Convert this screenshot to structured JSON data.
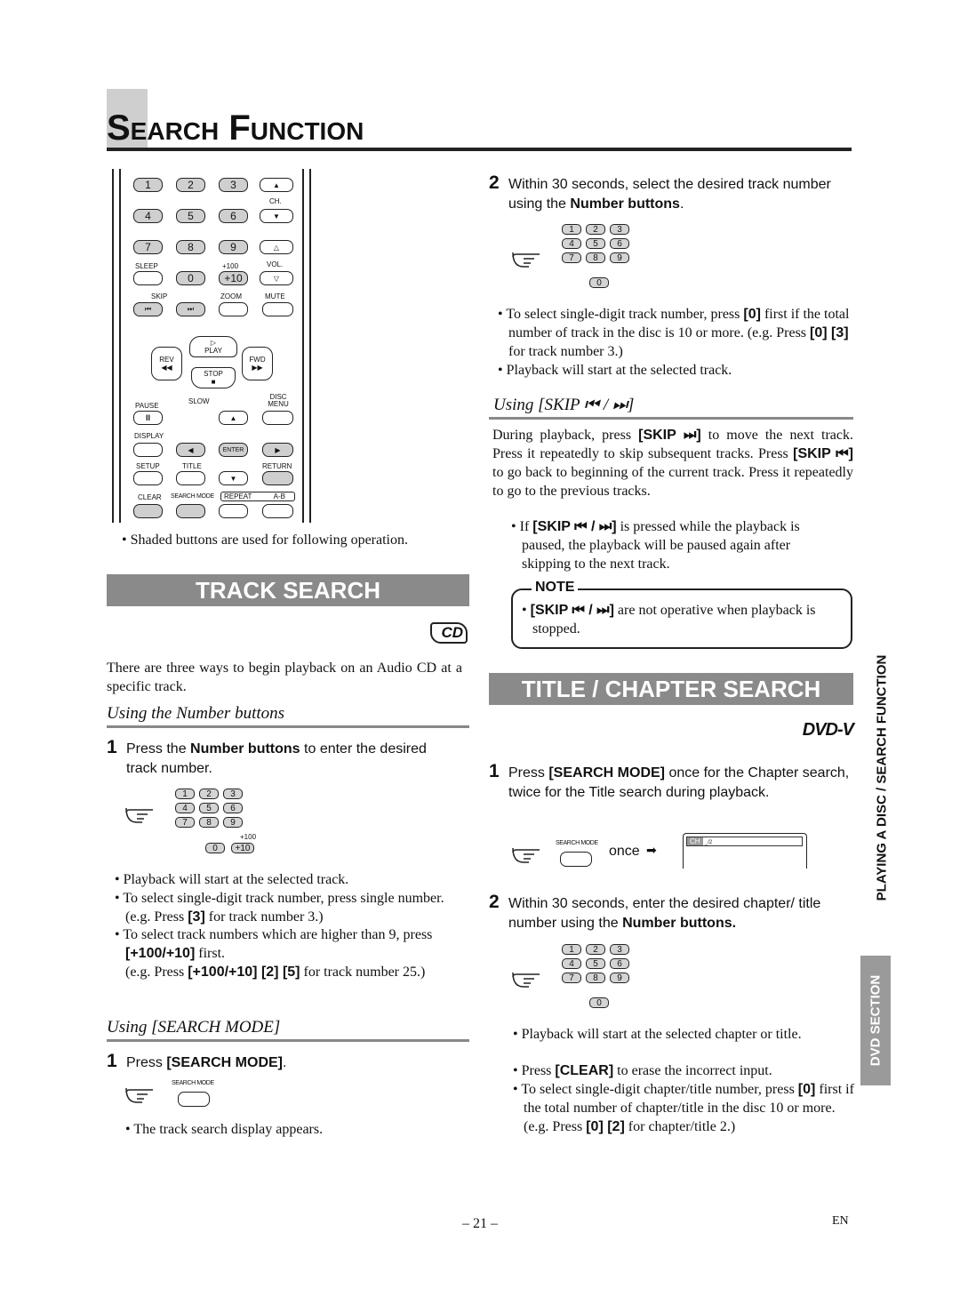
{
  "title": "Search Function",
  "remote": {
    "b1": "1",
    "b2": "2",
    "b3": "3",
    "b4": "4",
    "b5": "5",
    "b6": "6",
    "b7": "7",
    "b8": "8",
    "b9": "9",
    "b0": "0",
    "b10": "+10",
    "ch": "CH.",
    "vol": "VOL.",
    "sleep": "SLEEP",
    "plus100": "+100",
    "skip": "SKIP",
    "zoom": "ZOOM",
    "mute": "MUTE",
    "play": "PLAY",
    "rev": "REV",
    "fwd": "FWD",
    "stop": "STOP",
    "slow": "SLOW",
    "pause": "PAUSE",
    "disc_menu": "DISC MENU",
    "display": "DISPLAY",
    "enter": "ENTER",
    "setup": "SETUP",
    "title": "TITLE",
    "return": "RETURN",
    "clear": "CLEAR",
    "search_mode": "SEARCH MODE",
    "repeat": "REPEAT",
    "ab": "A-B",
    "skip_prev": "⏮",
    "skip_next": "⏭",
    "rev_sym": "◀◀",
    "fwd_sym": "▶▶",
    "stop_sym": "■",
    "pause_sym": "II"
  },
  "caption": "Shaded buttons are used for following operation.",
  "track_search": {
    "heading": "TRACK SEARCH",
    "logo": "CD",
    "intro": "There are three ways to begin playback on an Audio CD at a specific track.",
    "number_heading": "Using the Number buttons",
    "step1": {
      "num": "1",
      "a": "Press the ",
      "b": "Number buttons",
      "c": " to enter the desired track number."
    },
    "keypad": {
      "plus100": "+100",
      "plus10": "+10"
    },
    "bullets": [
      {
        "a": "Playback will start at the selected track."
      },
      {
        "a": "To select single-digit track number, press single number. (e.g. Press ",
        "b": "[3]",
        "c": " for track number 3.)"
      },
      {
        "a": "To select track numbers which are higher than 9, press ",
        "b": "[+100/+10]",
        "c": " first."
      }
    ],
    "example": {
      "a": "(e.g. Press ",
      "b": "[+100/+10] [2] [5]",
      "c": " for track number 25.)"
    },
    "search_mode_heading": "Using [SEARCH MODE]",
    "step_sm": {
      "num": "1",
      "a": "Press ",
      "b": "[SEARCH MODE]",
      "c": "."
    },
    "sm_label": "SEARCH MODE",
    "sm_bullet": "The track search display appears."
  },
  "right": {
    "step2": {
      "num": "2",
      "a": "Within 30 seconds, select the desired track number using the ",
      "b": "Number buttons",
      "c": "."
    },
    "bullets": [
      {
        "a": "To select single-digit track number, press ",
        "b": "[0]",
        "c": " first if the total number of track in the disc is 10 or more. (e.g. Press ",
        "d": "[0] [3]",
        "e": " for track number 3.)"
      },
      {
        "a": "Playback will start at the selected track."
      }
    ],
    "skip_heading": "Using [SKIP ⏮ / ⏭]",
    "skip_para": {
      "a": "During playback, press ",
      "b": "[SKIP ⏭]",
      "c": " to move the next track. Press it repeatedly to skip subsequent tracks. Press ",
      "d": "[SKIP ⏮]",
      "e": " to go back to beginning of the current track. Press it repeatedly to go to the previous tracks."
    },
    "skip_bullet": {
      "a": "If ",
      "b": "[SKIP ⏮ / ⏭]",
      "c": " is pressed while the playback is paused, the playback will be paused again after skipping to the next track."
    },
    "note": {
      "label": "NOTE",
      "b": "[SKIP ⏮ / ⏭]",
      "c": " are not operative when playback is stopped."
    },
    "chapter_heading": "TITLE / CHAPTER SEARCH",
    "logo": "DVD-V",
    "step1": {
      "num": "1",
      "a": "Press ",
      "b": "[SEARCH MODE]",
      "c": " once for the Chapter search, twice for the Title search during playback."
    },
    "sm_label": "SEARCH MODE",
    "once": "once",
    "display_ch": "CH",
    "display_val": "_/2",
    "step2b": {
      "num": "2",
      "a": "Within 30 seconds, enter the desired chapter/ title number using the ",
      "b": "Number buttons."
    },
    "bullets2": [
      {
        "a": "Playback will start at the selected chapter or title."
      },
      {
        "a": "Press ",
        "b": "[CLEAR]",
        "c": " to erase the incorrect input."
      },
      {
        "a": "To select single-digit chapter/title number, press ",
        "b": "[0]",
        "c": " first if the total number of chapter/title in the disc 10 or more. (e.g. Press ",
        "d": "[0] [2]",
        "e": " for chapter/title 2.)"
      }
    ]
  },
  "side": {
    "chapter": "PLAYING A DISC / SEARCH FUNCTION",
    "section": "DVD SECTION"
  },
  "footer": {
    "page": "– 21 –",
    "lang": "EN"
  }
}
